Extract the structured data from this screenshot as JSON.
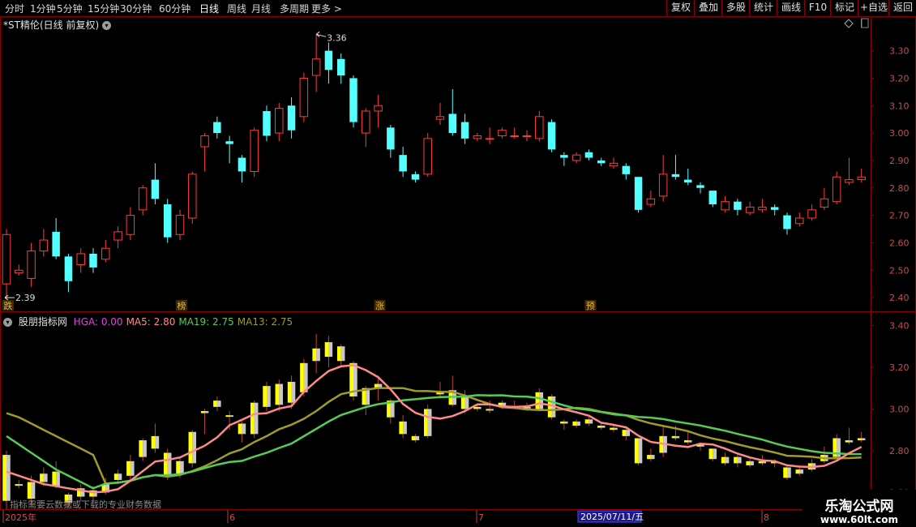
{
  "toolbar": {
    "periods": [
      "分时",
      "1分钟",
      "5分钟",
      "15分钟",
      "30分钟",
      "60分钟",
      "日线",
      "周线",
      "月线",
      "多周期",
      "更多 >"
    ],
    "active_period": "日线",
    "actions": [
      "复权",
      "叠加",
      "多股",
      "统计",
      "画线",
      "F10",
      "标记",
      "+自选",
      "返回"
    ]
  },
  "main_panel": {
    "title": "*ST精伦(日线 前复权)",
    "high_label": "3.36",
    "low_label": "2.39",
    "markers": [
      "跌",
      "榜",
      "涨",
      "预"
    ],
    "price_ticks": [
      "3.30",
      "3.20",
      "3.10",
      "3.00",
      "2.90",
      "2.80",
      "2.70",
      "2.60",
      "2.50",
      "2.40"
    ]
  },
  "indicator_panel": {
    "name": "股朋指标网",
    "legend": [
      {
        "label": "HGA: 0.00",
        "color": "#e040e0"
      },
      {
        "label": "MA5: 2.80",
        "color": "#ff8a8a"
      },
      {
        "label": "MA19: 2.75",
        "color": "#55cc55"
      },
      {
        "label": "MA13: 2.75",
        "color": "#a09a2a"
      }
    ],
    "ticks": [
      "3.40",
      "3.20",
      "3.00",
      "2.80",
      "2.60"
    ],
    "notice": "指标需要云数据或下载的专业财务数据"
  },
  "date_axis": {
    "labels": [
      "2025年",
      "6",
      "7",
      "8"
    ],
    "cursor_date": "2025/07/11/五"
  },
  "watermark": {
    "line1": "乐淘公式网",
    "line2": "www.60lt.com"
  },
  "colors": {
    "up": "#ff3b3b",
    "down": "#54ffff",
    "bg": "#000000",
    "border": "#8b0000",
    "yellow": "#ffff00"
  },
  "chart_data": {
    "type": "candlestick",
    "ylim": [
      2.35,
      3.42
    ],
    "candles": [
      [
        2.45,
        2.63,
        2.65,
        2.4
      ],
      [
        2.49,
        2.5,
        2.52,
        2.48
      ],
      [
        2.47,
        2.57,
        2.6,
        2.44
      ],
      [
        2.57,
        2.61,
        2.65,
        2.55
      ],
      [
        2.64,
        2.55,
        2.69,
        2.54
      ],
      [
        2.55,
        2.46,
        2.56,
        2.42
      ],
      [
        2.52,
        2.56,
        2.58,
        2.49
      ],
      [
        2.56,
        2.51,
        2.58,
        2.49
      ],
      [
        2.54,
        2.58,
        2.61,
        2.53
      ],
      [
        2.61,
        2.64,
        2.66,
        2.58
      ],
      [
        2.63,
        2.7,
        2.73,
        2.61
      ],
      [
        2.72,
        2.8,
        2.81,
        2.7
      ],
      [
        2.83,
        2.76,
        2.89,
        2.74
      ],
      [
        2.74,
        2.62,
        2.76,
        2.6
      ],
      [
        2.63,
        2.7,
        2.72,
        2.61
      ],
      [
        2.69,
        2.85,
        2.86,
        2.67
      ],
      [
        2.95,
        2.99,
        3.0,
        2.86
      ],
      [
        3.04,
        3.0,
        3.06,
        2.98
      ],
      [
        2.97,
        2.96,
        2.99,
        2.89
      ],
      [
        2.91,
        2.86,
        2.92,
        2.82
      ],
      [
        2.86,
        3.01,
        3.02,
        2.84
      ],
      [
        3.08,
        2.99,
        3.1,
        2.97
      ],
      [
        3.0,
        3.09,
        3.11,
        2.97
      ],
      [
        3.1,
        3.01,
        3.13,
        2.98
      ],
      [
        3.06,
        3.2,
        3.22,
        3.04
      ],
      [
        3.21,
        3.27,
        3.36,
        3.15
      ],
      [
        3.3,
        3.23,
        3.33,
        3.18
      ],
      [
        3.27,
        3.21,
        3.29,
        3.18
      ],
      [
        3.2,
        3.04,
        3.21,
        3.02
      ],
      [
        3.0,
        3.08,
        3.09,
        2.95
      ],
      [
        3.08,
        3.1,
        3.14,
        3.02
      ],
      [
        3.02,
        2.94,
        3.03,
        2.91
      ],
      [
        2.92,
        2.86,
        2.95,
        2.84
      ],
      [
        2.85,
        2.83,
        2.86,
        2.82
      ],
      [
        2.85,
        2.98,
        3.0,
        2.84
      ],
      [
        3.05,
        3.06,
        3.11,
        3.03
      ],
      [
        3.07,
        3.0,
        3.16,
        2.99
      ],
      [
        3.04,
        2.98,
        3.07,
        2.96
      ],
      [
        2.98,
        2.99,
        3.0,
        2.97
      ],
      [
        2.98,
        2.98,
        3.02,
        2.96
      ],
      [
        2.99,
        3.01,
        3.02,
        2.98
      ],
      [
        2.99,
        2.99,
        3.02,
        2.98
      ],
      [
        2.99,
        2.99,
        3.01,
        2.97
      ],
      [
        2.98,
        3.06,
        3.08,
        2.97
      ],
      [
        3.04,
        2.94,
        3.05,
        2.93
      ],
      [
        2.92,
        2.91,
        2.93,
        2.88
      ],
      [
        2.9,
        2.92,
        2.93,
        2.89
      ],
      [
        2.93,
        2.91,
        2.94,
        2.9
      ],
      [
        2.9,
        2.89,
        2.91,
        2.88
      ],
      [
        2.88,
        2.89,
        2.91,
        2.87
      ],
      [
        2.88,
        2.85,
        2.89,
        2.83
      ],
      [
        2.84,
        2.72,
        2.84,
        2.71
      ],
      [
        2.74,
        2.76,
        2.79,
        2.73
      ],
      [
        2.77,
        2.85,
        2.92,
        2.75
      ],
      [
        2.85,
        2.84,
        2.92,
        2.83
      ],
      [
        2.83,
        2.82,
        2.87,
        2.81
      ],
      [
        2.81,
        2.8,
        2.82,
        2.78
      ],
      [
        2.79,
        2.74,
        2.79,
        2.73
      ],
      [
        2.72,
        2.75,
        2.77,
        2.71
      ],
      [
        2.75,
        2.72,
        2.76,
        2.7
      ],
      [
        2.71,
        2.73,
        2.75,
        2.7
      ],
      [
        2.72,
        2.73,
        2.76,
        2.71
      ],
      [
        2.73,
        2.72,
        2.74,
        2.7
      ],
      [
        2.7,
        2.65,
        2.71,
        2.63
      ],
      [
        2.67,
        2.69,
        2.71,
        2.66
      ],
      [
        2.69,
        2.72,
        2.74,
        2.68
      ],
      [
        2.73,
        2.76,
        2.8,
        2.72
      ],
      [
        2.75,
        2.84,
        2.86,
        2.74
      ],
      [
        2.82,
        2.83,
        2.91,
        2.81
      ],
      [
        2.83,
        2.84,
        2.87,
        2.82
      ]
    ],
    "marker_positions": [
      0,
      14,
      30,
      47
    ],
    "indicator": {
      "ylim": [
        2.52,
        3.46
      ],
      "bars": [
        [
          2.56,
          2.78,
          2.8,
          2.52
        ],
        [
          2.64,
          2.64,
          2.66,
          2.62
        ],
        [
          2.57,
          2.65,
          2.68,
          2.54
        ],
        [
          2.65,
          2.69,
          2.72,
          2.63
        ],
        [
          2.7,
          2.63,
          2.75,
          2.62
        ],
        [
          2.59,
          2.55,
          2.6,
          2.53
        ],
        [
          2.58,
          2.62,
          2.64,
          2.56
        ],
        [
          2.61,
          2.58,
          2.63,
          2.56
        ],
        [
          2.6,
          2.64,
          2.67,
          2.59
        ],
        [
          2.66,
          2.69,
          2.71,
          2.64
        ],
        [
          2.68,
          2.75,
          2.78,
          2.66
        ],
        [
          2.77,
          2.85,
          2.86,
          2.75
        ],
        [
          2.87,
          2.81,
          2.93,
          2.79
        ],
        [
          2.79,
          2.68,
          2.81,
          2.66
        ],
        [
          2.69,
          2.75,
          2.77,
          2.67
        ],
        [
          2.74,
          2.89,
          2.9,
          2.72
        ],
        [
          2.98,
          2.99,
          3.0,
          2.88
        ],
        [
          3.04,
          3.01,
          3.06,
          2.99
        ],
        [
          2.97,
          2.97,
          2.99,
          2.9
        ],
        [
          2.93,
          2.88,
          2.94,
          2.84
        ],
        [
          2.88,
          3.03,
          3.04,
          2.86
        ],
        [
          3.11,
          3.01,
          3.13,
          2.99
        ],
        [
          3.02,
          3.12,
          3.14,
          2.99
        ],
        [
          3.13,
          3.03,
          3.16,
          3.0
        ],
        [
          3.08,
          3.22,
          3.24,
          3.06
        ],
        [
          3.23,
          3.29,
          3.36,
          3.17
        ],
        [
          3.32,
          3.25,
          3.35,
          3.2
        ],
        [
          3.3,
          3.23,
          3.31,
          3.2
        ],
        [
          3.22,
          3.06,
          3.23,
          3.04
        ],
        [
          3.02,
          3.1,
          3.11,
          2.97
        ],
        [
          3.1,
          3.12,
          3.16,
          3.04
        ],
        [
          3.04,
          2.96,
          3.05,
          2.93
        ],
        [
          2.94,
          2.88,
          2.97,
          2.86
        ],
        [
          2.87,
          2.85,
          2.88,
          2.84
        ],
        [
          2.87,
          3.0,
          3.02,
          2.86
        ],
        [
          3.07,
          3.08,
          3.13,
          3.05
        ],
        [
          3.09,
          3.02,
          3.16,
          3.01
        ],
        [
          3.06,
          3.0,
          3.09,
          2.98
        ],
        [
          3.0,
          3.01,
          3.02,
          2.99
        ],
        [
          3.0,
          3.0,
          3.04,
          2.98
        ],
        [
          3.01,
          3.03,
          3.04,
          3.0
        ],
        [
          3.01,
          3.01,
          3.04,
          3.0
        ],
        [
          3.01,
          3.01,
          3.03,
          2.99
        ],
        [
          3.0,
          3.08,
          3.1,
          2.99
        ],
        [
          3.06,
          2.96,
          3.07,
          2.95
        ],
        [
          2.94,
          2.93,
          2.95,
          2.9
        ],
        [
          2.92,
          2.94,
          2.95,
          2.91
        ],
        [
          2.95,
          2.93,
          2.96,
          2.92
        ],
        [
          2.92,
          2.91,
          2.93,
          2.9
        ],
        [
          2.9,
          2.91,
          2.93,
          2.89
        ],
        [
          2.9,
          2.87,
          2.91,
          2.85
        ],
        [
          2.86,
          2.74,
          2.86,
          2.73
        ],
        [
          2.76,
          2.78,
          2.81,
          2.75
        ],
        [
          2.79,
          2.87,
          2.92,
          2.77
        ],
        [
          2.87,
          2.86,
          2.92,
          2.85
        ],
        [
          2.85,
          2.84,
          2.89,
          2.83
        ],
        [
          2.83,
          2.82,
          2.84,
          2.8
        ],
        [
          2.81,
          2.76,
          2.81,
          2.75
        ],
        [
          2.74,
          2.77,
          2.79,
          2.73
        ],
        [
          2.77,
          2.74,
          2.78,
          2.72
        ],
        [
          2.73,
          2.75,
          2.77,
          2.72
        ],
        [
          2.74,
          2.75,
          2.78,
          2.73
        ],
        [
          2.75,
          2.74,
          2.76,
          2.72
        ],
        [
          2.72,
          2.67,
          2.73,
          2.66
        ],
        [
          2.69,
          2.71,
          2.73,
          2.68
        ],
        [
          2.71,
          2.74,
          2.76,
          2.7
        ],
        [
          2.75,
          2.78,
          2.82,
          2.74
        ],
        [
          2.77,
          2.86,
          2.88,
          2.76
        ],
        [
          2.84,
          2.85,
          2.91,
          2.83
        ],
        [
          2.85,
          2.86,
          2.89,
          2.84
        ]
      ]
    }
  }
}
